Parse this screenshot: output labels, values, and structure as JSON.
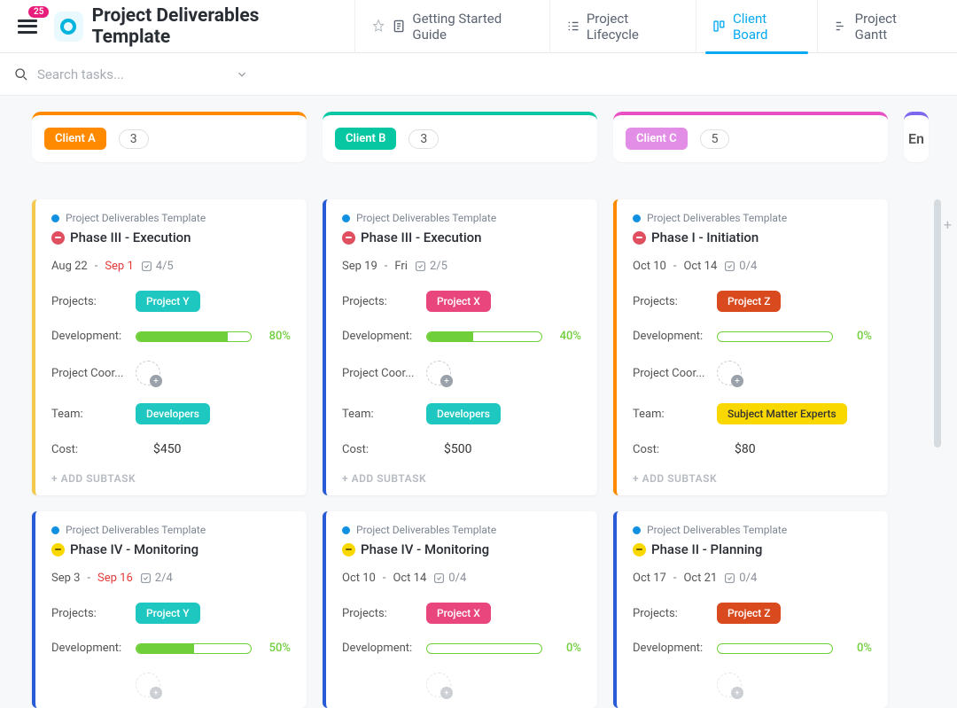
{
  "header": {
    "notification_count": "25",
    "title": "Project Deliverables Template",
    "tabs": [
      {
        "label": "Getting Started Guide",
        "icon": "doc"
      },
      {
        "label": "Project Lifecycle",
        "icon": "list"
      },
      {
        "label": "Client Board",
        "icon": "board",
        "active": true
      },
      {
        "label": "Project Gantt",
        "icon": "gantt"
      }
    ]
  },
  "search": {
    "placeholder": "Search tasks..."
  },
  "columns": [
    {
      "name": "Client A",
      "count": "3",
      "color": "#ff8a00",
      "chip_bg": "#ff8a00"
    },
    {
      "name": "Client B",
      "count": "3",
      "color": "#07c7a2",
      "chip_bg": "#07c7a2"
    },
    {
      "name": "Client C",
      "count": "5",
      "color": "#e950c3",
      "chip_bg": "#e28de6"
    }
  ],
  "extra_col_label": "En",
  "add_subtask_label": "+ ADD SUBTASK",
  "breadcrumb": "Project Deliverables Template",
  "labels": {
    "projects": "Projects:",
    "development": "Development:",
    "coordinator": "Project Coor...",
    "team": "Team:",
    "cost": "Cost:"
  },
  "cards": {
    "col0": [
      {
        "bar": "#f2c94c",
        "status": "red",
        "title": "Phase III - Execution",
        "date_a": "Aug 22",
        "date_b": "Sep 1",
        "past": true,
        "checks": "4/5",
        "project": "Project Y",
        "project_bg": "#1ec7c0",
        "dev": 80,
        "team": "Developers",
        "team_bg": "#1ec7c0",
        "cost": "$450"
      },
      {
        "bar": "#2a5bd7",
        "status": "yel",
        "title": "Phase IV - Monitoring",
        "date_a": "Sep 3",
        "date_b": "Sep 16",
        "past": true,
        "checks": "2/4",
        "project": "Project Y",
        "project_bg": "#1ec7c0",
        "dev": 50
      }
    ],
    "col1": [
      {
        "bar": "#2a5bd7",
        "status": "red",
        "title": "Phase III - Execution",
        "date_a": "Sep 19",
        "date_b": "Fri",
        "past": false,
        "checks": "2/5",
        "project": "Project X",
        "project_bg": "#e8467c",
        "dev": 40,
        "team": "Developers",
        "team_bg": "#1ec7c0",
        "cost": "$500"
      },
      {
        "bar": "#2a5bd7",
        "status": "yel",
        "title": "Phase IV - Monitoring",
        "date_a": "Oct 10",
        "date_b": "Oct 14",
        "past": false,
        "checks": "0/4",
        "project": "Project X",
        "project_bg": "#e8467c",
        "dev": 0
      }
    ],
    "col2": [
      {
        "bar": "#ff8a00",
        "status": "red",
        "title": "Phase I - Initiation",
        "date_a": "Oct 10",
        "date_b": "Oct 14",
        "past": false,
        "checks": "0/4",
        "project": "Project Z",
        "project_bg": "#d94a1f",
        "dev": 0,
        "team": "Subject Matter Experts",
        "team_bg": "#f9d800",
        "team_fg": "#333",
        "cost": "$80"
      },
      {
        "bar": "#2a5bd7",
        "status": "yel",
        "title": "Phase II - Planning",
        "date_a": "Oct 17",
        "date_b": "Oct 21",
        "past": false,
        "checks": "0/4",
        "project": "Project Z",
        "project_bg": "#d94a1f",
        "dev": 0
      }
    ]
  }
}
